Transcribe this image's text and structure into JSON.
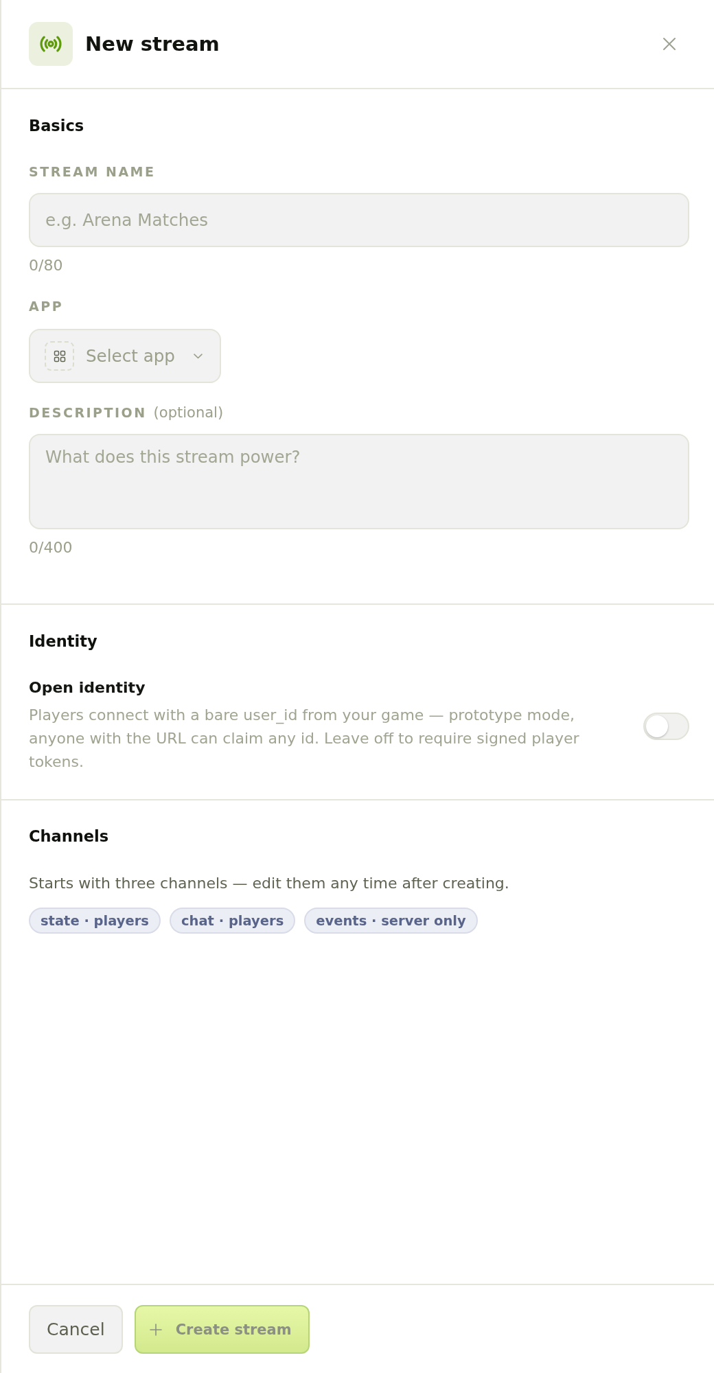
{
  "header": {
    "title": "New stream"
  },
  "basics": {
    "title": "Basics",
    "fields": [
      {
        "kind": "text",
        "label": "STREAM NAME",
        "placeholder": "e.g. Arena Matches",
        "counter": "0/80"
      },
      {
        "kind": "select",
        "label": "APP",
        "placeholder": "Select app"
      },
      {
        "kind": "textarea",
        "label": "DESCRIPTION",
        "hint": "(optional)",
        "placeholder": "What does this stream power?",
        "counter": "0/400"
      }
    ]
  },
  "identity": {
    "title": "Identity",
    "settings": [
      {
        "label": "Open identity",
        "description": "Players connect with a bare user_id from your game — prototype mode, anyone with the URL can claim any id. Leave off to require signed player tokens.",
        "on": false
      }
    ]
  },
  "channels": {
    "title": "Channels",
    "note": "Starts with three channels — edit them any time after creating.",
    "tags": [
      "state · players",
      "chat · players",
      "events · server only"
    ]
  },
  "footer": {
    "buttons": [
      {
        "kind": "secondary",
        "label": "Cancel",
        "disabled": false
      },
      {
        "kind": "primary",
        "label": "Create stream",
        "disabled": true
      }
    ]
  }
}
